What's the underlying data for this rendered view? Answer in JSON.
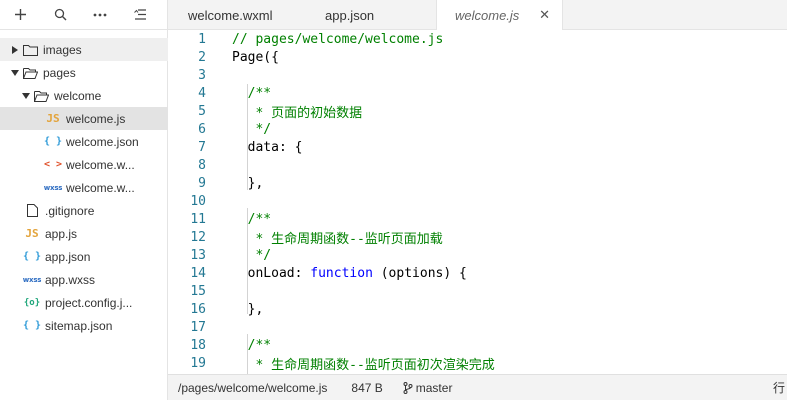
{
  "sidebar": {
    "toolbar": [
      "add-icon",
      "search-icon",
      "more-icon",
      "collapse-icon"
    ],
    "tree": [
      {
        "label": "images",
        "kind": "folder",
        "arrow": "right"
      },
      {
        "label": "pages",
        "kind": "folder-open",
        "arrow": "down"
      },
      {
        "label": "welcome",
        "kind": "folder-open",
        "arrow": "down"
      },
      {
        "label": "welcome.js",
        "kind": "js",
        "badge": "JS"
      },
      {
        "label": "welcome.json",
        "kind": "json",
        "badge": "{ }"
      },
      {
        "label": "welcome.w...",
        "kind": "wxml",
        "badge": "< >"
      },
      {
        "label": "welcome.w...",
        "kind": "wxss",
        "badge": "wxss"
      },
      {
        "label": ".gitignore",
        "kind": "file"
      },
      {
        "label": "app.js",
        "kind": "js",
        "badge": "JS"
      },
      {
        "label": "app.json",
        "kind": "json",
        "badge": "{ }"
      },
      {
        "label": "app.wxss",
        "kind": "wxss",
        "badge": "wxss"
      },
      {
        "label": "project.config.j...",
        "kind": "cfg",
        "badge": "{o}"
      },
      {
        "label": "sitemap.json",
        "kind": "json",
        "badge": "{ }"
      }
    ]
  },
  "tabs": [
    {
      "label": "welcome.wxml"
    },
    {
      "label": "app.json"
    },
    {
      "label": "welcome.js",
      "close": "✕"
    }
  ],
  "editor": {
    "lines": [
      {
        "n": "1",
        "code": "// pages/welcome/welcome.js"
      },
      {
        "n": "2",
        "code": "Page({"
      },
      {
        "n": "3",
        "code": ""
      },
      {
        "n": "4",
        "code": "  /**"
      },
      {
        "n": "5",
        "code": "   * 页面的初始数据"
      },
      {
        "n": "6",
        "code": "   */"
      },
      {
        "n": "7",
        "code": "  data: {"
      },
      {
        "n": "8",
        "code": ""
      },
      {
        "n": "9",
        "code": "  },"
      },
      {
        "n": "10",
        "code": ""
      },
      {
        "n": "11",
        "code": "  /**"
      },
      {
        "n": "12",
        "code": "   * 生命周期函数--监听页面加载"
      },
      {
        "n": "13",
        "code": "   */"
      },
      {
        "n": "14",
        "code": "  onLoad: function (options) {"
      },
      {
        "n": "15",
        "code": ""
      },
      {
        "n": "16",
        "code": "  },"
      },
      {
        "n": "17",
        "code": ""
      },
      {
        "n": "18",
        "code": "  /**"
      },
      {
        "n": "19",
        "code": "   * 生命周期函数--监听页面初次渲染完成"
      }
    ]
  },
  "status": {
    "path": "/pages/welcome/welcome.js",
    "size": "847 B",
    "branch": "master",
    "right": "行"
  },
  "colors": {
    "comment": "#008000",
    "keyword": "#0000ff",
    "line_number": "#237893",
    "js_icon": "#e3a43c",
    "json_icon": "#2f9bd8",
    "wxml_icon": "#e0532d"
  }
}
